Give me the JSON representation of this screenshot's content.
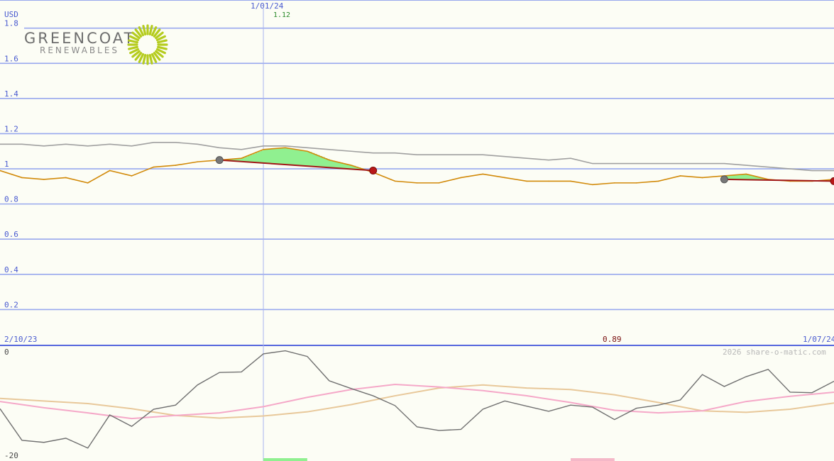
{
  "logo": {
    "line1": "GREENCOAT",
    "line2": "RENEWABLES"
  },
  "colors": {
    "background": "#fcfdf5",
    "grid": "#98a8ee",
    "axis_text": "#4a5bd0",
    "price": "#d28a0a",
    "avg": "#a0a0a0",
    "trend": "#a01818",
    "gain": "#90f090",
    "loss": "#f5b8c8",
    "osc": "#707070",
    "osc_pink": "#f5a8c8",
    "osc_tan": "#e8c89a",
    "logo_green": "#b5cc1e"
  },
  "chart_data": [
    {
      "type": "line",
      "unit": "USD",
      "ylim": [
        0,
        1.96
      ],
      "yticks": [
        "1.8",
        "1.6",
        "1.4",
        "1.2",
        "1",
        "0.8",
        "0.6",
        "0.4",
        "0.2"
      ],
      "ytick_values": [
        1.8,
        1.6,
        1.4,
        1.2,
        1.0,
        0.8,
        0.6,
        0.4,
        0.2
      ],
      "x_range": [
        0,
        38
      ],
      "start_label": "2/10/23",
      "end_label": "1/07/24",
      "marker_label": "1/01/24",
      "marker_x": 12,
      "marker_value": "1.12",
      "low_label": "0.89",
      "low_x": 28,
      "series": [
        {
          "key": "price",
          "x": [
            0,
            1,
            2,
            3,
            4,
            5,
            6,
            7,
            8,
            9,
            10,
            11,
            12,
            13,
            14,
            15,
            16,
            17,
            18,
            19,
            20,
            21,
            22,
            23,
            24,
            25,
            26,
            27,
            28,
            29,
            30,
            31,
            32,
            33,
            34,
            35,
            36,
            37,
            38
          ],
          "values": [
            0.99,
            0.95,
            0.94,
            0.95,
            0.92,
            0.99,
            0.96,
            1.01,
            1.02,
            1.04,
            1.05,
            1.06,
            1.11,
            1.12,
            1.1,
            1.05,
            1.02,
            0.98,
            0.93,
            0.92,
            0.92,
            0.95,
            0.97,
            0.95,
            0.93,
            0.93,
            0.93,
            0.91,
            0.92,
            0.92,
            0.93,
            0.96,
            0.95,
            0.96,
            0.97,
            0.94,
            0.93,
            0.93,
            0.94
          ]
        },
        {
          "key": "avg",
          "x": [
            0,
            1,
            2,
            3,
            4,
            5,
            6,
            7,
            8,
            9,
            10,
            11,
            12,
            13,
            14,
            15,
            16,
            17,
            18,
            19,
            20,
            21,
            22,
            23,
            24,
            25,
            26,
            27,
            28,
            29,
            30,
            31,
            32,
            33,
            34,
            35,
            36,
            37,
            38
          ],
          "values": [
            1.14,
            1.14,
            1.13,
            1.14,
            1.13,
            1.14,
            1.13,
            1.15,
            1.15,
            1.14,
            1.12,
            1.11,
            1.13,
            1.13,
            1.12,
            1.11,
            1.1,
            1.09,
            1.09,
            1.08,
            1.08,
            1.08,
            1.08,
            1.07,
            1.06,
            1.05,
            1.06,
            1.03,
            1.03,
            1.03,
            1.03,
            1.03,
            1.03,
            1.03,
            1.02,
            1.01,
            1.0,
            0.99,
            0.99
          ]
        }
      ],
      "trendlines": [
        {
          "x": [
            10,
            17
          ],
          "values": [
            1.05,
            0.99
          ]
        },
        {
          "x": [
            33,
            38
          ],
          "values": [
            0.94,
            0.93
          ]
        }
      ]
    },
    {
      "type": "line",
      "ylim": [
        -20,
        0
      ],
      "yticks": [
        "0",
        "-20"
      ],
      "ytick_values": [
        0,
        -20
      ],
      "copyright": "2026 share-o-matic.com",
      "x_range": [
        0,
        38
      ],
      "series": [
        {
          "key": "osc",
          "x": [
            0,
            1,
            2,
            3,
            4,
            5,
            6,
            7,
            8,
            9,
            10,
            11,
            12,
            13,
            14,
            15,
            16,
            17,
            18,
            19,
            20,
            21,
            22,
            23,
            24,
            25,
            26,
            27,
            28,
            29,
            30,
            31,
            32,
            33,
            34,
            35,
            36,
            37,
            38
          ],
          "values": [
            -11,
            -17.1,
            -17.5,
            -16.7,
            -18.6,
            -12.2,
            -14.4,
            -11.1,
            -10.3,
            -6.4,
            -4.0,
            -3.9,
            -0.4,
            0.2,
            -0.9,
            -5.6,
            -7.1,
            -8.5,
            -10.4,
            -14.5,
            -15.2,
            -15.0,
            -11.1,
            -9.5,
            -10.5,
            -11.5,
            -10.3,
            -10.7,
            -13.1,
            -10.9,
            -10.3,
            -9.3,
            -4.4,
            -6.7,
            -4.8,
            -3.4,
            -7.8,
            -7.9,
            -5.7
          ]
        },
        {
          "key": "osc_pink",
          "x": [
            0,
            2,
            4,
            6,
            8,
            10,
            12,
            14,
            16,
            18,
            20,
            22,
            24,
            26,
            28,
            30,
            32,
            34,
            36,
            38
          ],
          "values": [
            -9.6,
            -10.8,
            -11.8,
            -12.9,
            -12.3,
            -11.8,
            -10.6,
            -8.8,
            -7.3,
            -6.3,
            -6.8,
            -7.5,
            -8.5,
            -9.8,
            -11.3,
            -11.8,
            -11.4,
            -9.6,
            -8.6,
            -7.8
          ]
        },
        {
          "key": "osc_tan",
          "x": [
            0,
            2,
            4,
            6,
            8,
            10,
            12,
            14,
            16,
            18,
            20,
            22,
            24,
            26,
            28,
            30,
            32,
            34,
            36,
            38
          ],
          "values": [
            -9.0,
            -9.5,
            -10.0,
            -11.0,
            -12.3,
            -12.8,
            -12.4,
            -11.6,
            -10.2,
            -8.5,
            -7.0,
            -6.4,
            -7.0,
            -7.3,
            -8.3,
            -9.8,
            -11.4,
            -11.7,
            -11.1,
            -9.9
          ]
        }
      ]
    }
  ]
}
